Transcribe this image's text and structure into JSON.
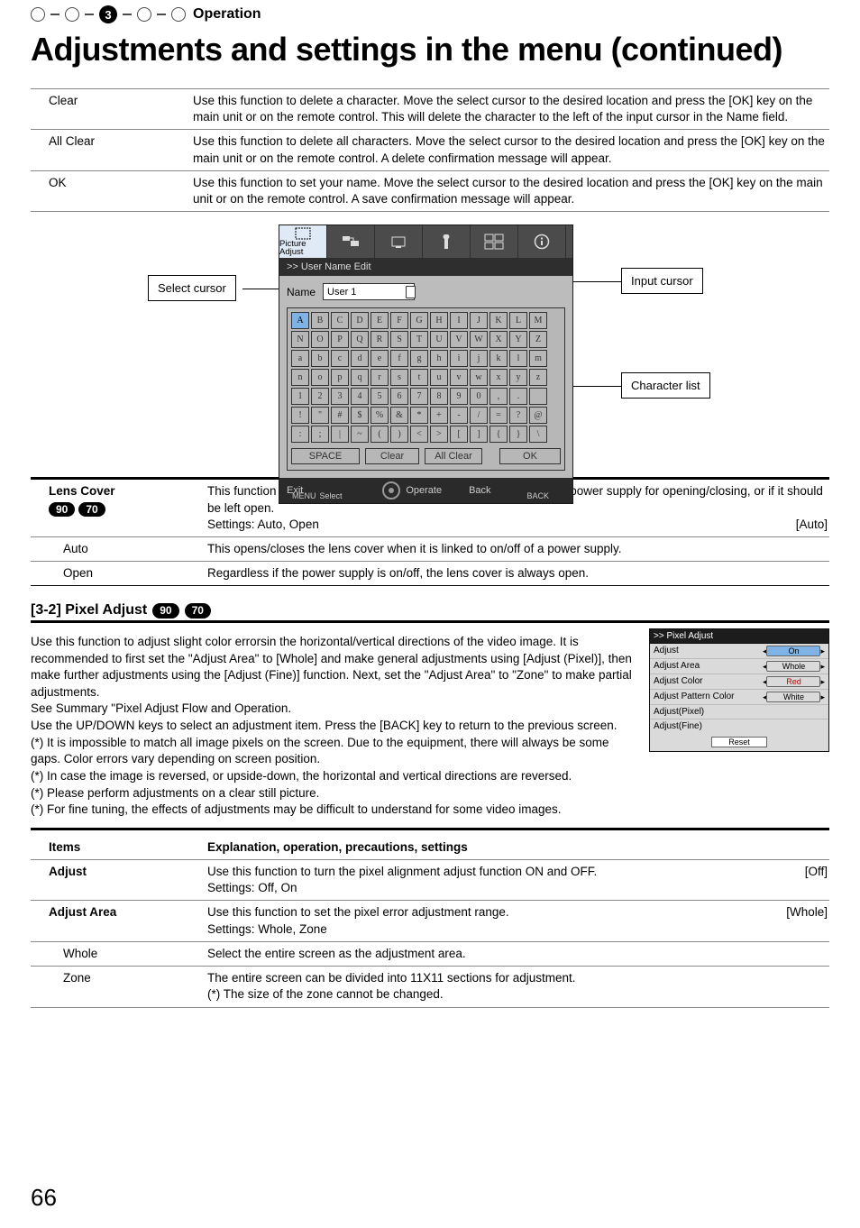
{
  "top": {
    "section": "Operation",
    "step_active": "3"
  },
  "heading": "Adjustments and settings in the menu (continued)",
  "name_edit_table": [
    {
      "label": "Clear",
      "desc": "Use this function to delete a character. Move the select cursor to the desired location and press the [OK] key on the main unit or on the remote control. This will delete the character to the left of the input cursor in the Name field."
    },
    {
      "label": "All Clear",
      "desc": "Use this function to delete all characters. Move the select cursor to the desired location and press the [OK] key on the main unit or on the remote control. A delete confirmation message will appear."
    },
    {
      "label": "OK",
      "desc": "Use this function to set your name. Move the select cursor to the desired location and press the [OK] key on the main unit or on the remote control. A save confirmation message will appear."
    }
  ],
  "figure": {
    "select_cursor": "Select cursor",
    "input_cursor": "Input cursor",
    "char_list": "Character list",
    "osd": {
      "active_tab": "Picture Adjust",
      "breadcrumb": ">> User Name Edit",
      "name_label": "Name",
      "name_value": "User 1",
      "rows": [
        [
          "A",
          "B",
          "C",
          "D",
          "E",
          "F",
          "G",
          "H",
          "I",
          "J",
          "K",
          "L",
          "M"
        ],
        [
          "N",
          "O",
          "P",
          "Q",
          "R",
          "S",
          "T",
          "U",
          "V",
          "W",
          "X",
          "Y",
          "Z"
        ],
        [
          "a",
          "b",
          "c",
          "d",
          "e",
          "f",
          "g",
          "h",
          "i",
          "j",
          "k",
          "l",
          "m"
        ],
        [
          "n",
          "o",
          "p",
          "q",
          "r",
          "s",
          "t",
          "u",
          "v",
          "w",
          "x",
          "y",
          "z"
        ],
        [
          "1",
          "2",
          "3",
          "4",
          "5",
          "6",
          "7",
          "8",
          "9",
          "0",
          ",",
          ".",
          ""
        ],
        [
          "!",
          "\"",
          "#",
          "$",
          "%",
          "&",
          "*",
          "+",
          "-",
          "/",
          "=",
          "?",
          "@"
        ],
        [
          ":",
          ";",
          "|",
          "~",
          "(",
          ")",
          "<",
          ">",
          "[",
          "]",
          "{",
          "}",
          "\\"
        ]
      ],
      "buttons": {
        "space": "SPACE",
        "clear": "Clear",
        "all_clear": "All Clear",
        "ok": "OK"
      },
      "footer": {
        "exit": "Exit",
        "menu": "MENU",
        "select": "Select",
        "operate": "Operate",
        "back": "Back",
        "back_small": "BACK"
      }
    }
  },
  "lens_cover": {
    "title": "Lens Cover",
    "badges": [
      "90",
      "70"
    ],
    "desc": "This function is used to set if the lens cover should be linked with a power supply for opening/closing, or if it should be left open.",
    "settings_line": "Settings: Auto, Open",
    "default": "[Auto]",
    "rows": [
      {
        "label": "Auto",
        "desc": "This opens/closes the lens cover when it is linked to on/off of a power supply."
      },
      {
        "label": "Open",
        "desc": "Regardless if the power supply is on/off, the lens cover is always open."
      }
    ]
  },
  "pixel_adjust": {
    "title": "[3-2] Pixel Adjust",
    "badges": [
      "90",
      "70"
    ],
    "para": [
      "Use this function to adjust slight color errorsin the horizontal/vertical directions of the video image. It is recommended to first set the \"Adjust Area\" to [Whole] and make general adjustments using [Adjust (Pixel)], then make further adjustments using the [Adjust (Fine)] function. Next, set the \"Adjust Area\" to \"Zone\" to make partial adjustments.",
      "See Summary \"Pixel Adjust Flow and Operation.",
      "Use the UP/DOWN keys to select an adjustment item. Press the [BACK] key to return to the previous screen.",
      "(*) It is impossible to match all image pixels on the screen. Due to the equipment, there will always be some gaps. Color errors vary depending on screen position.",
      "(*) In case the image is reversed, or upside-down, the horizontal and vertical directions are reversed.",
      "(*) Please perform adjustments on a clear still picture.",
      "(*) For fine tuning, the effects of adjustments may be difficult to understand for some video images."
    ],
    "mini_osd": {
      "title": ">> Pixel Adjust",
      "rows": [
        {
          "label": "Adjust",
          "chip": "On",
          "selected": true
        },
        {
          "label": "Adjust Area",
          "chip": "Whole"
        },
        {
          "label": "Adjust Color",
          "chip": "Red",
          "red": true
        },
        {
          "label": "Adjust Pattern Color",
          "chip": "White"
        },
        {
          "label": "Adjust(Pixel)",
          "chip": ""
        },
        {
          "label": "Adjust(Fine)",
          "chip": ""
        }
      ],
      "reset": "Reset"
    }
  },
  "items_table": {
    "head": {
      "col1": "Items",
      "col2": "Explanation, operation, precautions, settings"
    },
    "rows": [
      {
        "label": "Adjust",
        "desc": "Use this function to turn the pixel alignment adjust function ON and OFF.",
        "settings": "Settings: Off, On",
        "default": "[Off]",
        "bold": true
      },
      {
        "label": "Adjust Area",
        "desc": "Use this function to set the pixel error adjustment range.",
        "settings": "Settings: Whole, Zone",
        "default": "[Whole]",
        "bold": true
      },
      {
        "label": "Whole",
        "desc": "Select the entire screen as the adjustment area.",
        "sub": true
      },
      {
        "label": "Zone",
        "desc": "The entire screen can be divided into 11X11 sections for adjustment.\n(*) The size of the zone cannot be changed.",
        "sub": true
      }
    ]
  },
  "page_number": "66"
}
